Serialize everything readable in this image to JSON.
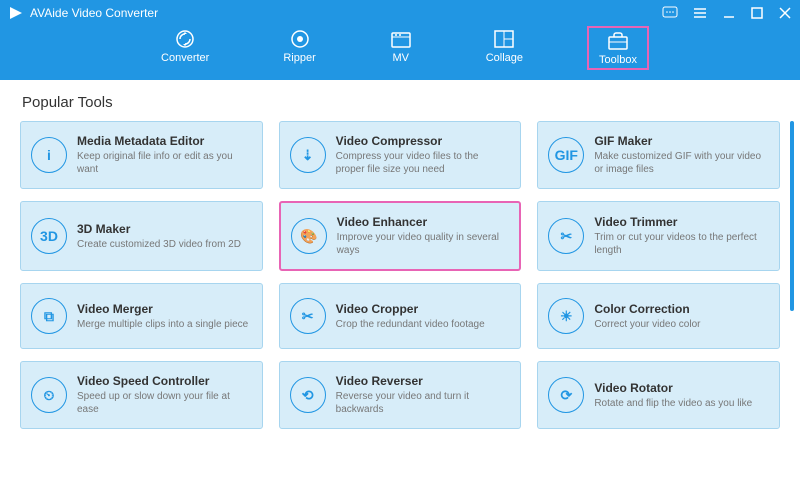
{
  "app": {
    "title": "AVAide Video Converter"
  },
  "tabs": [
    {
      "label": "Converter"
    },
    {
      "label": "Ripper"
    },
    {
      "label": "MV"
    },
    {
      "label": "Collage"
    },
    {
      "label": "Toolbox"
    }
  ],
  "section": {
    "title": "Popular Tools"
  },
  "tools": [
    {
      "icon": "i",
      "title": "Media Metadata Editor",
      "desc": "Keep original file info or edit as you want"
    },
    {
      "icon": "⇣",
      "title": "Video Compressor",
      "desc": "Compress your video files to the proper file size you need"
    },
    {
      "icon": "GIF",
      "title": "GIF Maker",
      "desc": "Make customized GIF with your video or image files"
    },
    {
      "icon": "3D",
      "title": "3D Maker",
      "desc": "Create customized 3D video from 2D"
    },
    {
      "icon": "🎨",
      "title": "Video Enhancer",
      "desc": "Improve your video quality in several ways"
    },
    {
      "icon": "✂",
      "title": "Video Trimmer",
      "desc": "Trim or cut your videos to the perfect length"
    },
    {
      "icon": "⧉",
      "title": "Video Merger",
      "desc": "Merge multiple clips into a single piece"
    },
    {
      "icon": "✂",
      "title": "Video Cropper",
      "desc": "Crop the redundant video footage"
    },
    {
      "icon": "☀",
      "title": "Color Correction",
      "desc": "Correct your video color"
    },
    {
      "icon": "⏲",
      "title": "Video Speed Controller",
      "desc": "Speed up or slow down your file at ease"
    },
    {
      "icon": "⟲",
      "title": "Video Reverser",
      "desc": "Reverse your video and turn it backwards"
    },
    {
      "icon": "⟳",
      "title": "Video Rotator",
      "desc": "Rotate and flip the video as you like"
    }
  ]
}
